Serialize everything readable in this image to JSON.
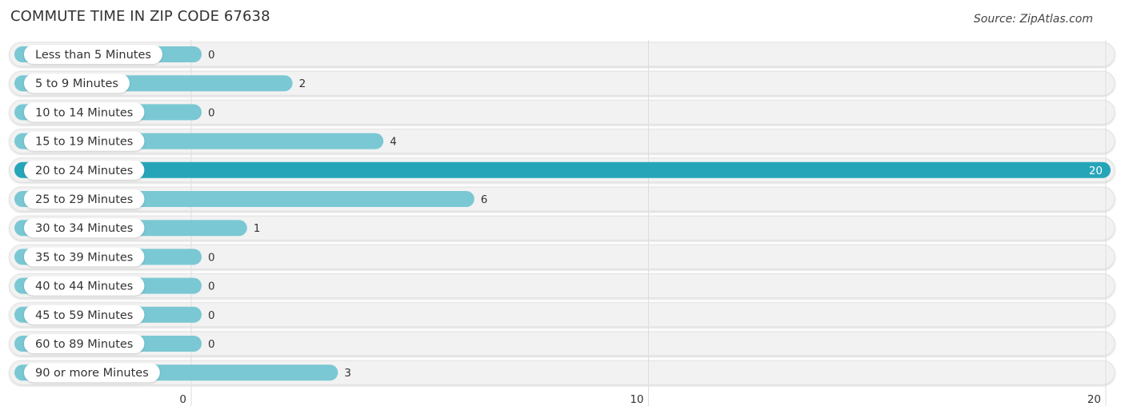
{
  "header": {
    "title": "COMMUTE TIME IN ZIP CODE 67638",
    "source": "Source: ZipAtlas.com"
  },
  "colors": {
    "bar": "#7ac8d3",
    "bar_highlight": "#26a5b9",
    "track": "#f2f2f2",
    "gridline": "#dddddd"
  },
  "chart_data": {
    "type": "bar",
    "orientation": "horizontal",
    "title": "COMMUTE TIME IN ZIP CODE 67638",
    "xlabel": "",
    "ylabel": "",
    "xlim": [
      0,
      20
    ],
    "x_ticks": [
      0,
      10,
      20
    ],
    "grid": true,
    "highlight_index": 4,
    "categories": [
      "Less than 5 Minutes",
      "5 to 9 Minutes",
      "10 to 14 Minutes",
      "15 to 19 Minutes",
      "20 to 24 Minutes",
      "25 to 29 Minutes",
      "30 to 34 Minutes",
      "35 to 39 Minutes",
      "40 to 44 Minutes",
      "45 to 59 Minutes",
      "60 to 89 Minutes",
      "90 or more Minutes"
    ],
    "values": [
      0,
      2,
      0,
      4,
      20,
      6,
      1,
      0,
      0,
      0,
      0,
      3
    ]
  }
}
